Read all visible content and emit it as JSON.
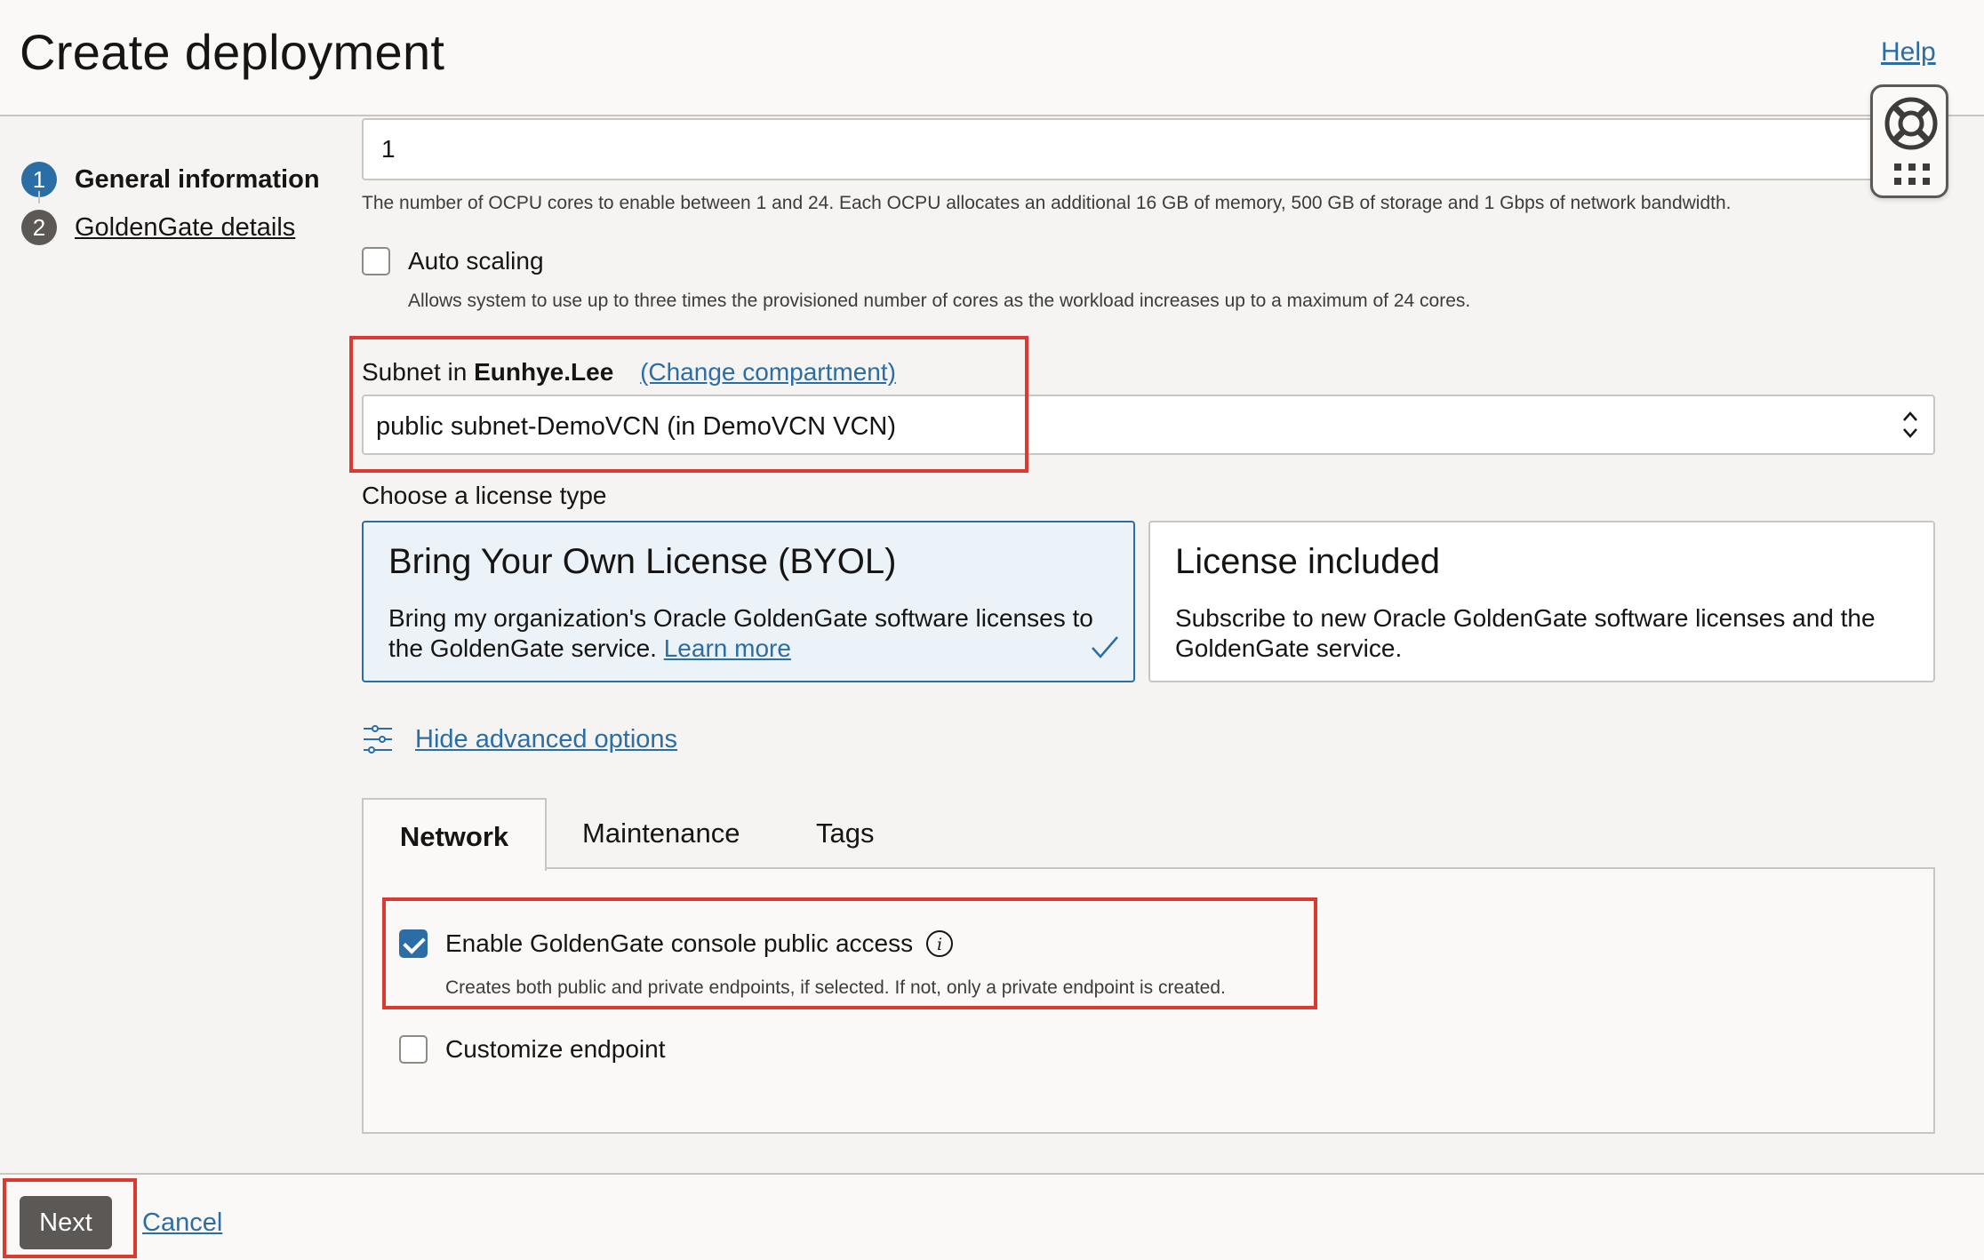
{
  "header": {
    "title": "Create deployment",
    "help_label": "Help"
  },
  "steps": [
    {
      "number": "1",
      "label": "General information"
    },
    {
      "number": "2",
      "label": "GoldenGate details"
    }
  ],
  "ocpu": {
    "value": "1",
    "help": "The number of OCPU cores to enable between 1 and 24. Each OCPU allocates an additional 16 GB of memory, 500 GB of storage and 1 Gbps of network bandwidth."
  },
  "auto_scaling": {
    "label": "Auto scaling",
    "checked": false,
    "help": "Allows system to use up to three times the provisioned number of cores as the workload increases up to a maximum of 24 cores."
  },
  "subnet": {
    "label_prefix": "Subnet in",
    "compartment": "Eunhye.Lee",
    "change_compartment": "(Change compartment)",
    "value": "public subnet-DemoVCN (in DemoVCN VCN)"
  },
  "license": {
    "title": "Choose a license type",
    "options": [
      {
        "title": "Bring Your Own License (BYOL)",
        "desc": "Bring my organization's Oracle GoldenGate software licenses to the GoldenGate service.",
        "link": "Learn more",
        "selected": true
      },
      {
        "title": "License included",
        "desc": "Subscribe to new Oracle GoldenGate software licenses and the GoldenGate service.",
        "selected": false
      }
    ]
  },
  "advanced": {
    "label": "Hide advanced options"
  },
  "tabs": [
    {
      "label": "Network",
      "active": true
    },
    {
      "label": "Maintenance",
      "active": false
    },
    {
      "label": "Tags",
      "active": false
    }
  ],
  "network": {
    "public_access_label": "Enable GoldenGate console public access",
    "public_access_checked": true,
    "public_access_help": "Creates both public and private endpoints, if selected. If not, only a private endpoint is created.",
    "customize_label": "Customize endpoint",
    "customize_checked": false
  },
  "footer": {
    "next_label": "Next",
    "cancel_label": "Cancel"
  },
  "colors": {
    "accent": "#2a6ea5",
    "highlight": "#dc3a2e",
    "button": "#5b5855"
  }
}
